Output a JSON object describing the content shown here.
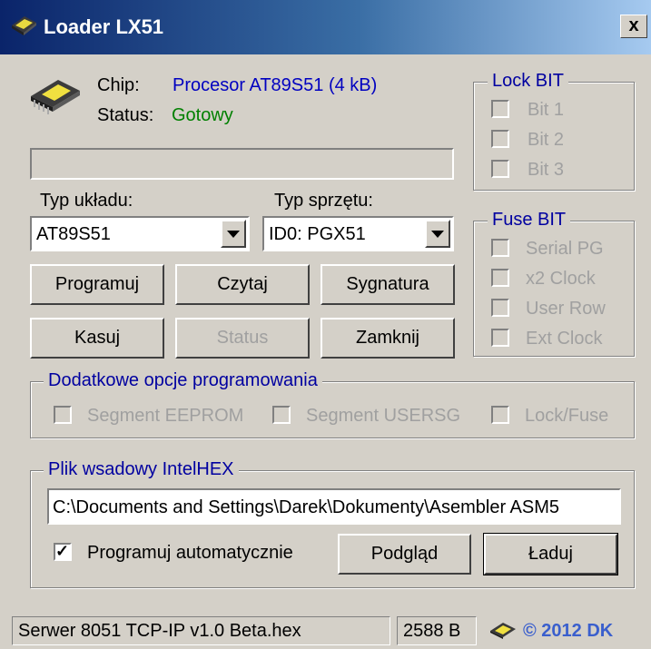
{
  "window": {
    "title": "Loader LX51",
    "close_label": "x"
  },
  "chip": {
    "chip_label": "Chip:",
    "chip_value": "Procesor AT89S51 (4 kB)",
    "status_label": "Status:",
    "status_value": "Gotowy"
  },
  "progress": {
    "value": 0
  },
  "type_selects": {
    "device_label": "Typ układu:",
    "device_value": "AT89S51",
    "hardware_label": "Typ sprzętu:",
    "hardware_value": "ID0: PGX51"
  },
  "buttons": {
    "program": "Programuj",
    "read": "Czytaj",
    "signature": "Sygnatura",
    "erase": "Kasuj",
    "status": "Status",
    "close": "Zamknij"
  },
  "lock_bit": {
    "legend": "Lock BIT",
    "items": [
      "Bit 1",
      "Bit 2",
      "Bit 3"
    ]
  },
  "fuse_bit": {
    "legend": "Fuse BIT",
    "items": [
      "Serial PG",
      "x2 Clock",
      "User Row",
      "Ext Clock"
    ]
  },
  "extra_options": {
    "legend": "Dodatkowe opcje programowania",
    "items": [
      "Segment EEPROM",
      "Segment USERSG",
      "Lock/Fuse"
    ]
  },
  "hex_file": {
    "legend": "Plik wsadowy IntelHEX",
    "path": "C:\\Documents and Settings\\Darek\\Dokumenty\\Asembler ASM5",
    "auto_program_label": "Programuj automatycznie",
    "auto_program_checked": true,
    "preview_button": "Podgląd",
    "load_button": "Ładuj"
  },
  "statusbar": {
    "file": "Serwer 8051 TCP-IP v1.0 Beta.hex",
    "size": "2588 B",
    "copyright": "© 2012 DK"
  }
}
